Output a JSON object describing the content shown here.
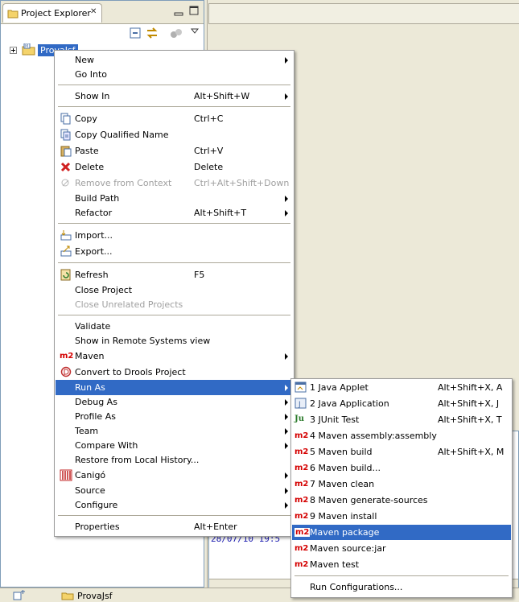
{
  "explorer": {
    "tab_title": "Project Explorer",
    "project_name": "ProvaJsf"
  },
  "console": {
    "line": "28/07/10 19:5"
  },
  "status": {
    "label": "ProvaJsf"
  },
  "context_menu": {
    "items": [
      {
        "label": "New",
        "shortcut": ""
      },
      {
        "label": "Go Into",
        "shortcut": ""
      },
      {
        "label": "Show In",
        "shortcut": "Alt+Shift+W"
      },
      {
        "label": "Copy",
        "shortcut": "Ctrl+C"
      },
      {
        "label": "Copy Qualified Name",
        "shortcut": ""
      },
      {
        "label": "Paste",
        "shortcut": "Ctrl+V"
      },
      {
        "label": "Delete",
        "shortcut": "Delete"
      },
      {
        "label": "Remove from Context",
        "shortcut": "Ctrl+Alt+Shift+Down"
      },
      {
        "label": "Build Path",
        "shortcut": ""
      },
      {
        "label": "Refactor",
        "shortcut": "Alt+Shift+T"
      },
      {
        "label": "Import...",
        "shortcut": ""
      },
      {
        "label": "Export...",
        "shortcut": ""
      },
      {
        "label": "Refresh",
        "shortcut": "F5"
      },
      {
        "label": "Close Project",
        "shortcut": ""
      },
      {
        "label": "Close Unrelated Projects",
        "shortcut": ""
      },
      {
        "label": "Validate",
        "shortcut": ""
      },
      {
        "label": "Show in Remote Systems view",
        "shortcut": ""
      },
      {
        "label": "Maven",
        "shortcut": ""
      },
      {
        "label": "Convert to Drools Project",
        "shortcut": ""
      },
      {
        "label": "Run As",
        "shortcut": ""
      },
      {
        "label": "Debug As",
        "shortcut": ""
      },
      {
        "label": "Profile As",
        "shortcut": ""
      },
      {
        "label": "Team",
        "shortcut": ""
      },
      {
        "label": "Compare With",
        "shortcut": ""
      },
      {
        "label": "Restore from Local History...",
        "shortcut": ""
      },
      {
        "label": "Canigó",
        "shortcut": ""
      },
      {
        "label": "Source",
        "shortcut": ""
      },
      {
        "label": "Configure",
        "shortcut": ""
      },
      {
        "label": "Properties",
        "shortcut": "Alt+Enter"
      }
    ]
  },
  "run_as_menu": {
    "items": [
      {
        "label": "1 Java Applet",
        "shortcut": "Alt+Shift+X, A"
      },
      {
        "label": "2 Java Application",
        "shortcut": "Alt+Shift+X, J"
      },
      {
        "label": "3 JUnit Test",
        "shortcut": "Alt+Shift+X, T"
      },
      {
        "label": "4 Maven assembly:assembly",
        "shortcut": ""
      },
      {
        "label": "5 Maven build",
        "shortcut": "Alt+Shift+X, M"
      },
      {
        "label": "6 Maven build...",
        "shortcut": ""
      },
      {
        "label": "7 Maven clean",
        "shortcut": ""
      },
      {
        "label": "8 Maven generate-sources",
        "shortcut": ""
      },
      {
        "label": "9 Maven install",
        "shortcut": ""
      },
      {
        "label": "Maven package",
        "shortcut": ""
      },
      {
        "label": "Maven source:jar",
        "shortcut": ""
      },
      {
        "label": "Maven test",
        "shortcut": ""
      },
      {
        "label": "Run Configurations...",
        "shortcut": ""
      }
    ]
  },
  "icon_text": {
    "m2": "m2",
    "ju": "Ju"
  },
  "colors": {
    "selection": "#316AC5",
    "disabled_text": "#A0A0A0",
    "maven_red": "#D40000"
  }
}
